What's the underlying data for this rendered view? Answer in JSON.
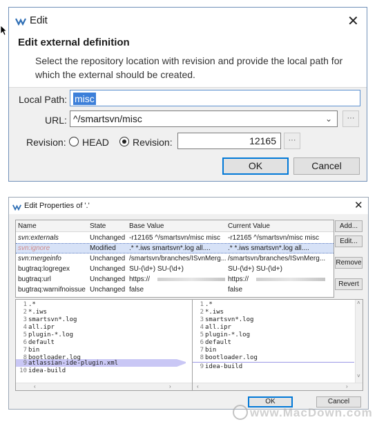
{
  "edit_dialog": {
    "title": "Edit",
    "heading": "Edit external definition",
    "description": "Select the repository location with revision and provide the local path for which the external should be created.",
    "local_path_label": "Local Path:",
    "local_path_value": "misc",
    "url_label": "URL:",
    "url_value": "^/smartsvn/misc",
    "revision_label": "Revision:",
    "head_option": "HEAD",
    "revision_option": "Revision:",
    "revision_value": "12165",
    "selected_option": "Revision",
    "ok_label": "OK",
    "cancel_label": "Cancel"
  },
  "props_dialog": {
    "title": "Edit Properties of '.'",
    "columns": [
      "Name",
      "State",
      "Base Value",
      "Current Value"
    ],
    "rows": [
      {
        "name": "svn:externals",
        "state": "Unchanged",
        "base": "-r12165 ^/smartsvn/misc misc",
        "current": "-r12165 ^/smartsvn/misc misc",
        "italic": true,
        "selected": false
      },
      {
        "name": "svn:ignore",
        "state": "Modified",
        "base": ".* *.iws smartsvn*.log all....",
        "current": ".* *.iws smartsvn*.log all....",
        "italic": true,
        "selected": true
      },
      {
        "name": "svn:mergeinfo",
        "state": "Unchanged",
        "base": "/smartsvn/branches/ISvnMerg...",
        "current": "/smartsvn/branches/ISvnMerg...",
        "italic": true,
        "selected": false
      },
      {
        "name": "bugtraq:logregex",
        "state": "Unchanged",
        "base": "SU-(\\d+) SU-(\\d+)",
        "current": "SU-(\\d+) SU-(\\d+)",
        "italic": false,
        "selected": false
      },
      {
        "name": "bugtraq:url",
        "state": "Unchanged",
        "base": "https://",
        "current": "https://",
        "italic": false,
        "selected": false
      },
      {
        "name": "bugtraq:warnifnoissue",
        "state": "Unchanged",
        "base": "false",
        "current": "false",
        "italic": false,
        "selected": false
      }
    ],
    "side_buttons": [
      "Add...",
      "Edit...",
      "Remove",
      "Revert"
    ],
    "left_lines": [
      ".*",
      "*.iws",
      "smartsvn*.log",
      "all.ipr",
      "plugin-*.log",
      "default",
      "bin",
      "bootloader.log",
      "atlassian-ide-plugin.xml",
      "idea-build"
    ],
    "right_lines": [
      ".*",
      "*.iws",
      "smartsvn*.log",
      "all.ipr",
      "plugin-*.log",
      "default",
      "bin",
      "bootloader.log",
      "idea-build"
    ],
    "removed_line_index": 9,
    "ok_label": "OK",
    "cancel_label": "Cancel"
  },
  "watermark": "www.MacDown.com",
  "colors": {
    "selection": "#cfe0f7",
    "diff_removed": "#c9c7f5",
    "ignored_name": "#d08a8a",
    "accent": "#0078d7"
  }
}
